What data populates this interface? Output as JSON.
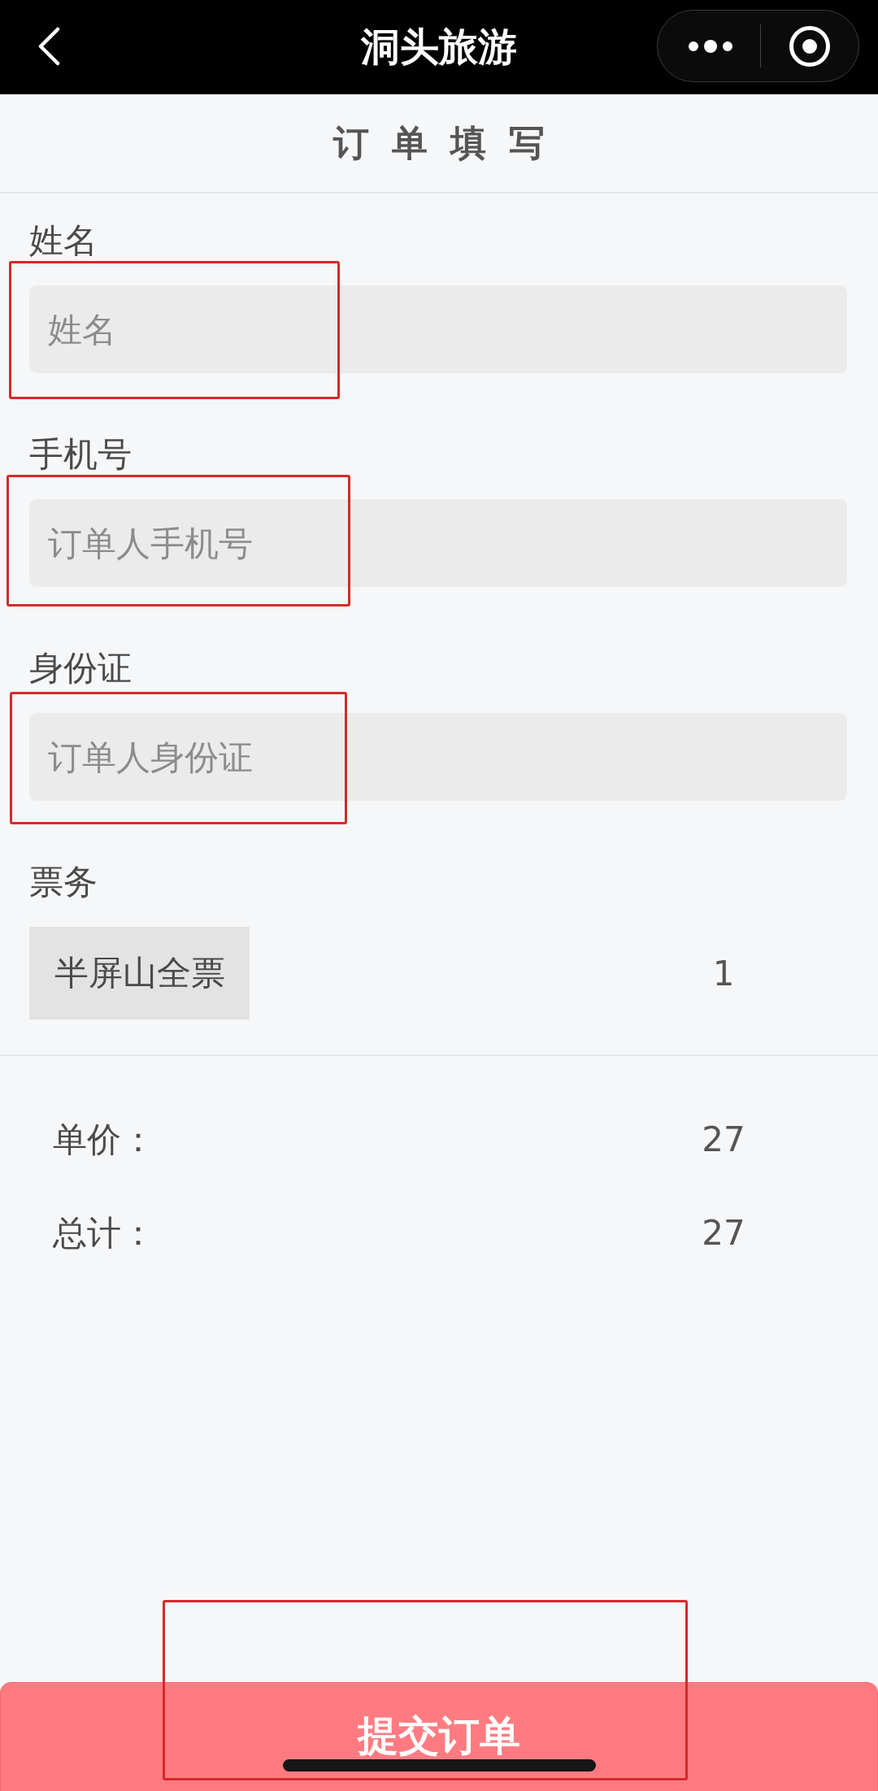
{
  "nav_bar": {
    "title": "洞头旅游"
  },
  "page_header": {
    "title": "订单填写"
  },
  "fields": [
    {
      "label": "姓名",
      "placeholder": "姓名",
      "highlighted": true
    },
    {
      "label": "手机号",
      "placeholder": "订单人手机号",
      "highlighted": true
    },
    {
      "label": "身份证",
      "placeholder": "订单人身份证",
      "highlighted": true
    }
  ],
  "tickets": {
    "label": "票务",
    "items": [
      {
        "name": "半屏山全票",
        "count": "1"
      }
    ]
  },
  "summary": [
    {
      "label": "单价：",
      "value": "27"
    },
    {
      "label": "总计：",
      "value": "27"
    }
  ],
  "submit_button": {
    "label": "提交订单",
    "highlighted": true
  }
}
